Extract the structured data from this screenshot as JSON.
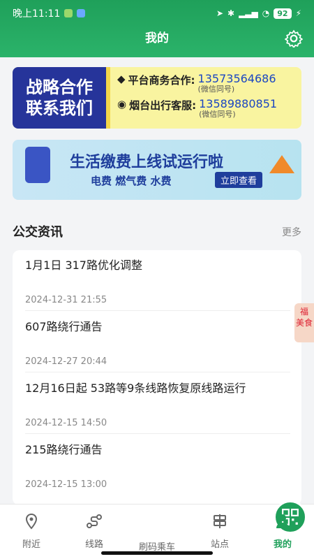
{
  "status_bar": {
    "time": "晚上11:11",
    "battery": "92"
  },
  "header": {
    "title": "我的"
  },
  "banner_partner": {
    "left_lines": [
      "战略合作",
      "联系我们"
    ],
    "rows": [
      {
        "label": "平台商务合作:",
        "value": "13573564686",
        "note": "(微信同号)"
      },
      {
        "label": "烟台出行客服:",
        "value": "13589880851",
        "note": "(微信同号)"
      }
    ]
  },
  "banner_payment": {
    "title": "生活缴费上线试运行啦",
    "subtitle": "电费 燃气费 水费",
    "button": "立即查看"
  },
  "news_section": {
    "title": "公交资讯",
    "more": "更多"
  },
  "news": [
    {
      "title": "1月1日 317路优化调整",
      "time": "2024-12-31 21:55"
    },
    {
      "title": "607路绕行通告",
      "time": "2024-12-27 20:44"
    },
    {
      "title": "12月16日起 53路等9条线路恢复原线路运行",
      "time": "2024-12-15 14:50"
    },
    {
      "title": "215路绕行通告",
      "time": "2024-12-15 13:00"
    }
  ],
  "float_tag": {
    "line1": "福",
    "line2": "美食"
  },
  "tabbar": {
    "tabs": [
      {
        "label": "附近",
        "icon": "location-pin-icon"
      },
      {
        "label": "线路",
        "icon": "route-icon"
      },
      {
        "label": "刷码乘车",
        "icon": "qr-code-icon"
      },
      {
        "label": "站点",
        "icon": "station-sign-icon"
      },
      {
        "label": "我的",
        "icon": "person-icon"
      }
    ]
  },
  "colors": {
    "brand_green": "#1fa05a",
    "banner_blue": "#26349a",
    "phone_blue": "#1b46c2"
  }
}
